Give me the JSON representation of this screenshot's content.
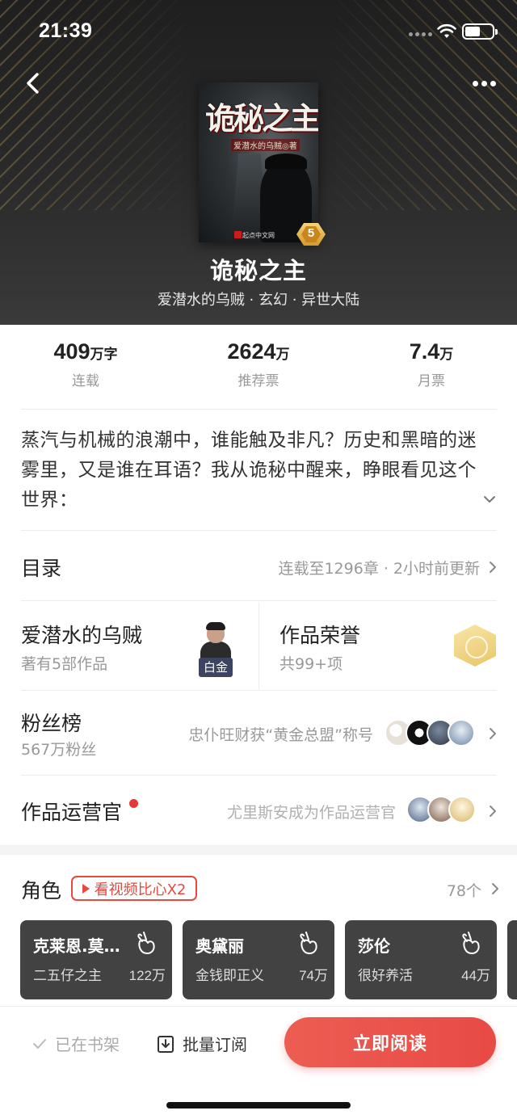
{
  "status_bar": {
    "time": "21:39"
  },
  "book": {
    "title": "诡秘之主",
    "meta": "爱潜水的乌贼 · 玄幻 · 异世大陆",
    "cover_title": "诡秘之主",
    "cover_author": "爱潜水的乌贼◎著",
    "cover_publisher": "起点中文网",
    "level": "5"
  },
  "stats": [
    {
      "value": "409",
      "unit": "万字",
      "label": "连载"
    },
    {
      "value": "2624",
      "unit": "万",
      "label": "推荐票"
    },
    {
      "value": "7.4",
      "unit": "万",
      "label": "月票"
    }
  ],
  "synopsis": "蒸汽与机械的浪潮中，谁能触及非凡？历史和黑暗的迷雾里，又是谁在耳语？我从诡秘中醒来，睁眼看见这个世界：",
  "catalog": {
    "title": "目录",
    "status": "连载至1296章 · 2小时前更新"
  },
  "author": {
    "name": "爱潜水的乌贼",
    "works": "著有5部作品",
    "badge": "白金"
  },
  "honors": {
    "title": "作品荣誉",
    "count": "共99+项"
  },
  "fans": {
    "title": "粉丝榜",
    "count": "567万粉丝",
    "news": "忠仆旺财获“黄金总盟”称号"
  },
  "operator": {
    "title": "作品运营官",
    "news": "尤里斯安成为作品运营官"
  },
  "characters": {
    "title": "角色",
    "video_button": "看视频比心X2",
    "count": "78个",
    "items": [
      {
        "name": "克莱恩.莫…",
        "desc": "二五仔之主",
        "votes": "122万"
      },
      {
        "name": "奥黛丽",
        "desc": "金钱即正义",
        "votes": "74万"
      },
      {
        "name": "莎伦",
        "desc": "很好养活",
        "votes": "44万"
      }
    ]
  },
  "bottom_bar": {
    "shelf": "已在书架",
    "batch": "批量订阅",
    "read": "立即阅读"
  },
  "colors": {
    "accent": "#e84a45",
    "card": "#424242",
    "gold": "#d39a2c"
  }
}
